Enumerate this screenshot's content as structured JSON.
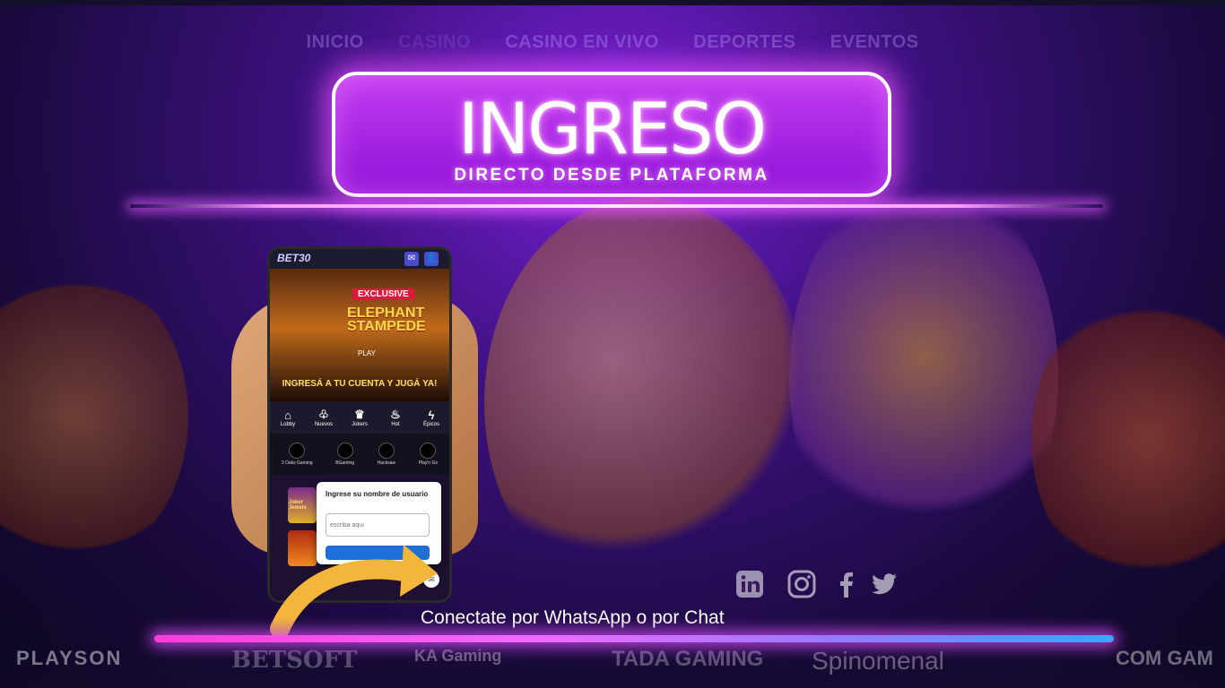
{
  "nav": {
    "items": [
      "INICIO",
      "CASINO",
      "CASINO EN VIVO",
      "DEPORTES",
      "EVENTOS"
    ],
    "active": "CASINO"
  },
  "banner": {
    "title": "INGRESO",
    "subtitle": "DIRECTO DESDE PLATAFORMA"
  },
  "phone": {
    "logo": "BET30",
    "promo": {
      "badge": "EXCLUSIVE",
      "game": "ELEPHANT STAMPEDE",
      "provider": "PLAY",
      "cta": "INGRESÁ A TU CUENTA Y JUGÁ YA!"
    },
    "categories": [
      "Lobby",
      "Nuevos",
      "Jokers",
      "Hot",
      "Épicos"
    ],
    "providers": [
      "3 Oaks Gaming",
      "BGaming",
      "Hacksaw",
      "Play'n Go"
    ],
    "games": [
      "Joker Jewels"
    ],
    "dialog": {
      "title": "Ingrese su nombre de usuario",
      "placeholder": "escriba aquí"
    }
  },
  "social": [
    "linkedin-icon",
    "instagram-icon",
    "facebook-icon",
    "twitter-icon"
  ],
  "footer": {
    "text": "Conectate por WhatsApp o por Chat"
  },
  "partners": [
    "PLAYSON",
    "BETSOFT",
    "KA Gaming",
    "TADA GAMING",
    "Spinomenal",
    "COM GAM"
  ],
  "colors": {
    "banner": "#9a1ee0",
    "glow": "#ff9cff",
    "background": "#2a0d5e"
  }
}
